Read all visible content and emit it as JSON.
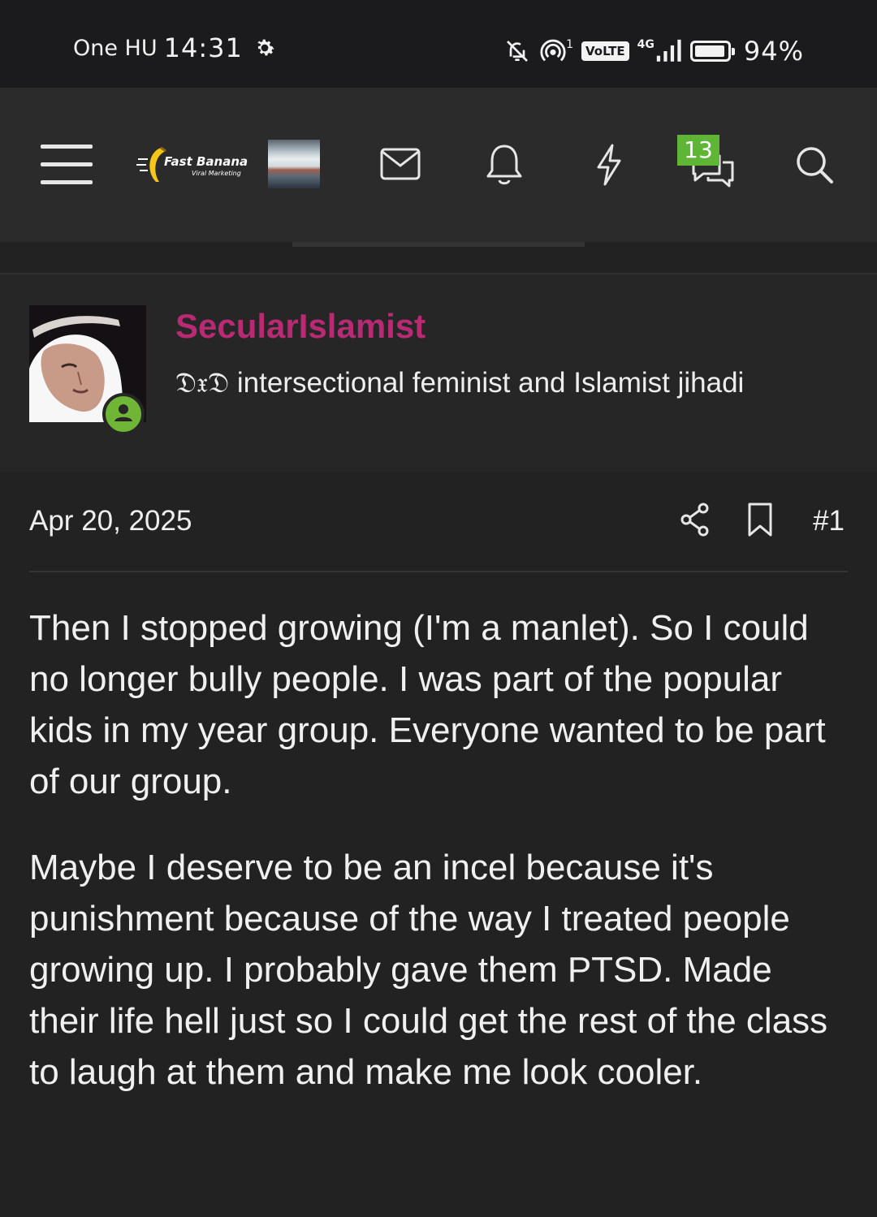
{
  "status_bar": {
    "carrier": "One HU",
    "time": "14:31",
    "sim_indicator": "1",
    "volte": "VoLTE",
    "network": "4G",
    "battery": "94%",
    "battery_level": 0.94,
    "icons": [
      "gear-icon",
      "bell-muted-icon",
      "hotspot-icon",
      "signal-icon",
      "battery-icon"
    ]
  },
  "nav": {
    "logo_text": "Fast Banana",
    "logo_subtext": "Viral Marketing",
    "conversations_badge": "13",
    "icons": [
      "menu-icon",
      "envelope-icon",
      "bell-icon",
      "lightning-icon",
      "chat-icon",
      "search-icon"
    ]
  },
  "post": {
    "username": "SecularIslamist",
    "user_title_prefix": "𝔇𝔵𝔇",
    "user_title": "intersectional feminist and Islamist jihadi",
    "date": "Apr 20, 2025",
    "post_number": "#1",
    "paragraphs": [
      "Then I stopped growing (I'm a manlet). So I could no longer bully people. I was part of the popular kids in my year group. Everyone wanted to be part of our group.",
      "Maybe I deserve to be an incel because it's punishment because of the way I treated people growing up. I probably gave them PTSD. Made their life hell just so I could get the rest of the class to laugh at them and make me look cooler."
    ]
  },
  "colors": {
    "background": "#222222",
    "navbar": "#2b2b2b",
    "username": "#b82a73",
    "badge": "#5fb636",
    "online": "#6fb536"
  }
}
